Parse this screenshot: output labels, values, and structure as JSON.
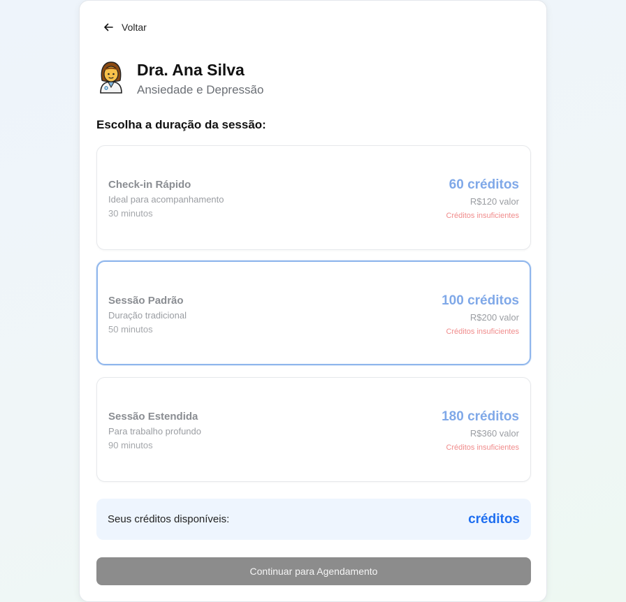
{
  "nav": {
    "back_label": "Voltar"
  },
  "doctor": {
    "name": "Dra. Ana Silva",
    "specialty": "Ansiedade e Depressão"
  },
  "section_title": "Escolha a duração da sessão:",
  "options": [
    {
      "name": "Check-in Rápido",
      "description": "Ideal para acompanhamento",
      "duration": "30 minutos",
      "credits": "60 créditos",
      "value": "R$120 valor",
      "status": "Créditos insuficientes",
      "selected": false
    },
    {
      "name": "Sessão Padrão",
      "description": "Duração tradicional",
      "duration": "50 minutos",
      "credits": "100 créditos",
      "value": "R$200 valor",
      "status": "Créditos insuficientes",
      "selected": true
    },
    {
      "name": "Sessão Estendida",
      "description": "Para trabalho profundo",
      "duration": "90 minutos",
      "credits": "180 créditos",
      "value": "R$360 valor",
      "status": "Créditos insuficientes",
      "selected": false
    }
  ],
  "balance": {
    "label": "Seus créditos disponíveis:",
    "value": "créditos"
  },
  "continue_label": "Continuar para Agendamento",
  "colors": {
    "accent": "#1e6ef0",
    "credits_muted": "#7fa8e8",
    "error": "#f08b8b",
    "selected_border": "#8fb6ec",
    "button_disabled": "#8c8c8c"
  }
}
